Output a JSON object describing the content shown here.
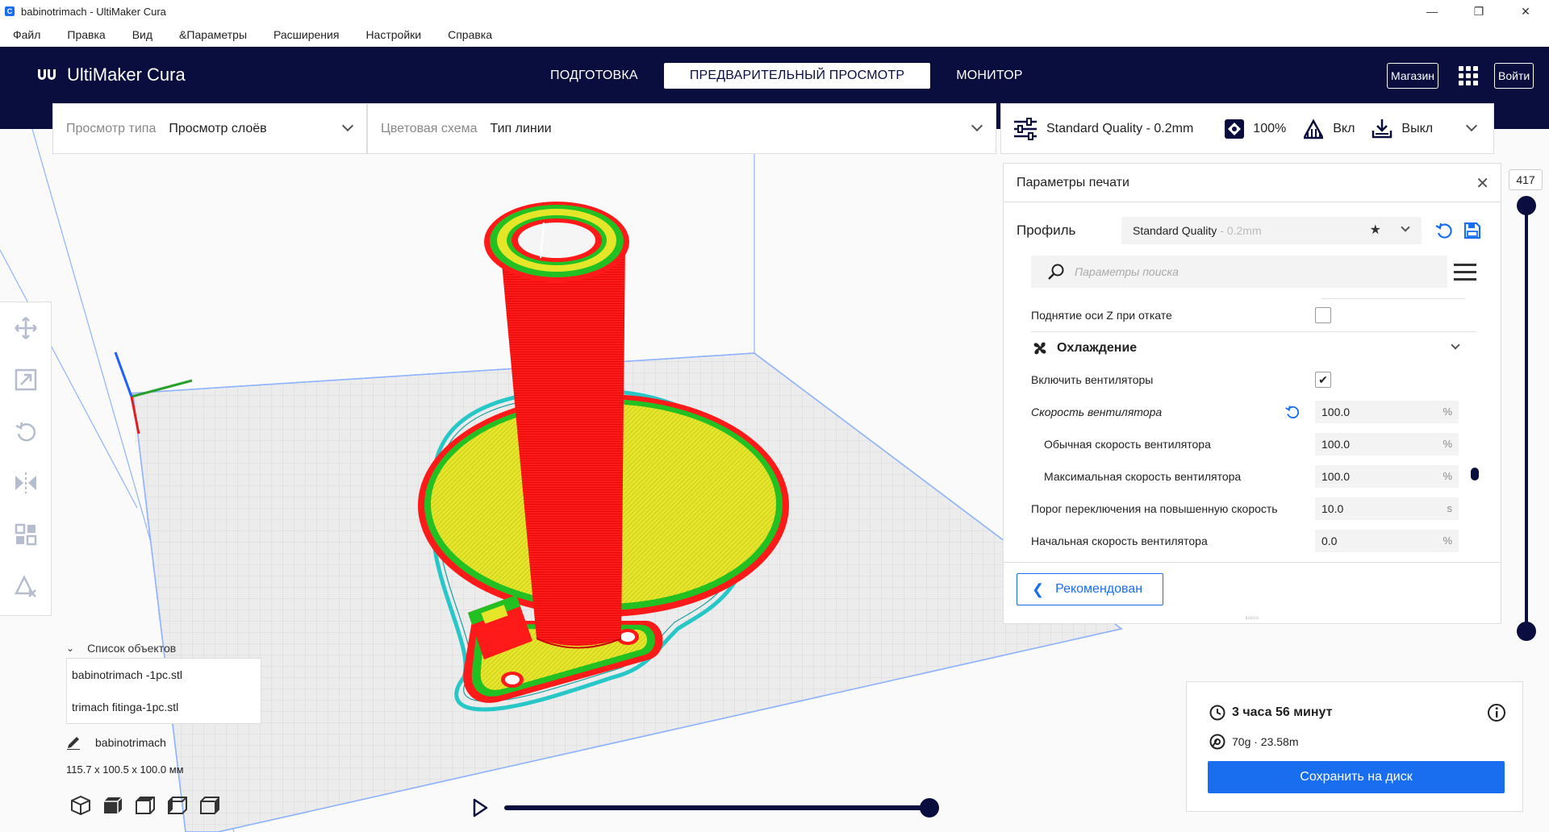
{
  "window": {
    "title": "babinotrimach - UltiMaker Cura",
    "minimize": "—",
    "maximize": "❐",
    "close": "✕"
  },
  "menu": [
    "Файл",
    "Правка",
    "Вид",
    "&Параметры",
    "Расширения",
    "Настройки",
    "Справка"
  ],
  "header": {
    "brand": "UltiMaker Cura",
    "tabs": [
      "ПОДГОТОВКА",
      "ПРЕДВАРИТЕЛЬНЫЙ ПРОСМОТР",
      "МОНИТОР"
    ],
    "active_tab": 1,
    "marketplace": "Магазин",
    "sign_in": "Войти"
  },
  "view_type": {
    "label": "Просмотр типа",
    "value": "Просмотр слоёв"
  },
  "color_scheme": {
    "label": "Цветовая схема",
    "value": "Тип линии"
  },
  "print_setup": {
    "profile": "Standard Quality - 0.2mm",
    "infill": "100%",
    "support": "Вкл",
    "adhesion": "Выкл"
  },
  "settings_panel": {
    "title": "Параметры печати",
    "profile_label": "Профиль",
    "profile_value": "Standard Quality",
    "profile_suffix": "- 0.2mm",
    "search_placeholder": "Параметры поиска",
    "rows": {
      "z_hop": "Поднятие оси Z при откате",
      "cooling": "Охлаждение",
      "enable_fans": "Включить вентиляторы",
      "fan_speed": "Скорость вентилятора",
      "fan_speed_value": "100.0",
      "regular_fan": "Обычная скорость вентилятора",
      "regular_fan_value": "100.0",
      "max_fan": "Максимальная скорость вентилятора",
      "max_fan_value": "100.0",
      "threshold": "Порог переключения на повышенную скорость",
      "threshold_value": "10.0",
      "initial_fan": "Начальная скорость вентилятора",
      "initial_fan_value": "0.0",
      "unit_percent": "%",
      "unit_seconds": "s"
    },
    "recommended_button": "Рекомендован"
  },
  "layer_slider": {
    "value": "417"
  },
  "object_list": {
    "toggle_label": "Список объектов",
    "items": [
      "babinotrimach -1pc.stl",
      "trimach fitinga-1pc.stl"
    ],
    "project_name": "babinotrimach",
    "dimensions": "115.7 x 100.5 x 100.0 мм"
  },
  "job": {
    "time": "3 часа 56 минут",
    "material": "70g · 23.58m",
    "save_button": "Сохранить на диск"
  },
  "icons": [
    "move-icon",
    "scale-icon",
    "rotate-icon",
    "mirror-icon",
    "per-model-settings-icon",
    "support-blocker-icon"
  ],
  "colors": {
    "header": "#0a0e3f",
    "accent": "#196ef0",
    "wall_outer": "#ff1a1a",
    "wall_inner": "#22c022",
    "infill": "#e5e52a",
    "skirt": "#27c7c7"
  }
}
